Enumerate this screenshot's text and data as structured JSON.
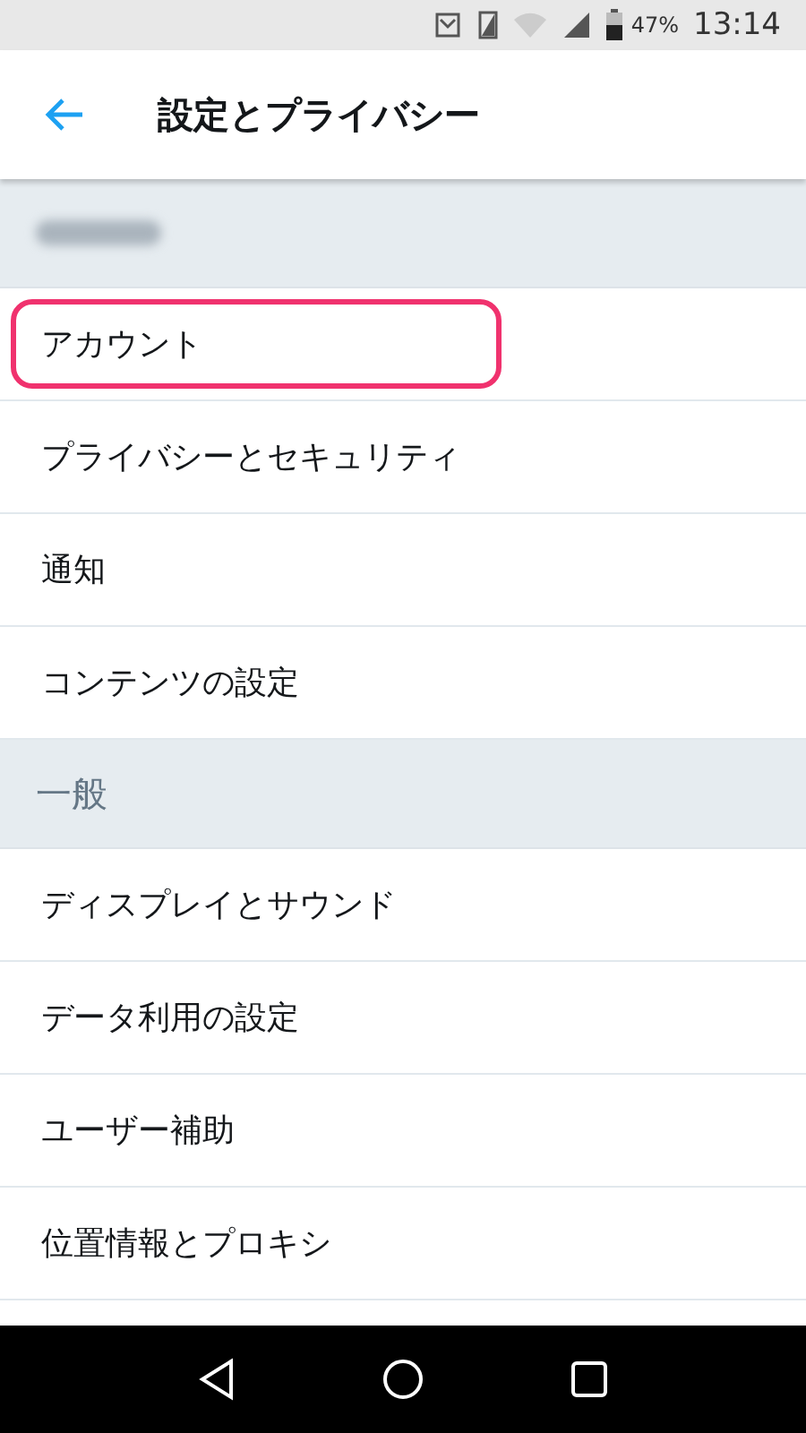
{
  "status_bar": {
    "battery": "47%",
    "time": "13:14"
  },
  "app_bar": {
    "title": "設定とプライバシー"
  },
  "sections": [
    {
      "redacted": true,
      "items": [
        {
          "label": "アカウント",
          "highlighted": true
        },
        {
          "label": "プライバシーとセキュリティ",
          "highlighted": false
        },
        {
          "label": "通知",
          "highlighted": false
        },
        {
          "label": "コンテンツの設定",
          "highlighted": false
        }
      ]
    },
    {
      "header": "一般",
      "redacted": false,
      "items": [
        {
          "label": "ディスプレイとサウンド",
          "highlighted": false
        },
        {
          "label": "データ利用の設定",
          "highlighted": false
        },
        {
          "label": "ユーザー補助",
          "highlighted": false
        },
        {
          "label": "位置情報とプロキシ",
          "highlighted": false
        }
      ]
    }
  ]
}
